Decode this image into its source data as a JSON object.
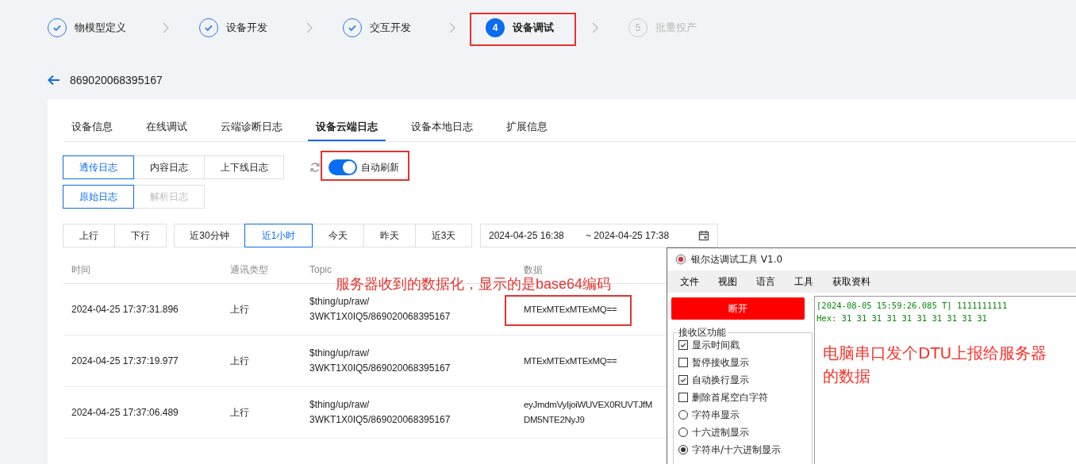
{
  "steps": [
    {
      "completed": true,
      "selected": false,
      "label": "物模型定义"
    },
    {
      "completed": true,
      "selected": false,
      "label": "设备开发"
    },
    {
      "completed": true,
      "selected": false,
      "label": "交互开发"
    },
    {
      "completed": false,
      "selected": true,
      "number": "4",
      "label": "设备调试",
      "highlighted": true
    },
    {
      "completed": false,
      "selected": false,
      "number": "5",
      "label": "批量投产"
    }
  ],
  "device_id": "869020068395167",
  "tabs": [
    {
      "label": "设备信息",
      "selected": false
    },
    {
      "label": "在线调试",
      "selected": false
    },
    {
      "label": "云端诊断日志",
      "selected": false
    },
    {
      "label": "设备云端日志",
      "selected": true
    },
    {
      "label": "设备本地日志",
      "selected": false
    },
    {
      "label": "扩展信息",
      "selected": false
    }
  ],
  "log_types": [
    {
      "label": "透传日志",
      "selected": true
    },
    {
      "label": "内容日志",
      "selected": false
    },
    {
      "label": "上下线日志",
      "selected": false
    }
  ],
  "log_formats": [
    {
      "label": "原始日志",
      "selected": true,
      "disabled": false
    },
    {
      "label": "解析日志",
      "selected": false,
      "disabled": true
    }
  ],
  "auto_refresh": {
    "label": "自动刷新",
    "on": true,
    "highlighted": true
  },
  "direction_filters": [
    {
      "label": "上行",
      "selected": false
    },
    {
      "label": "下行",
      "selected": false
    }
  ],
  "time_ranges": [
    {
      "label": "近30分钟",
      "selected": false
    },
    {
      "label": "近1小时",
      "selected": true
    },
    {
      "label": "今天",
      "selected": false
    },
    {
      "label": "昨天",
      "selected": false
    },
    {
      "label": "近3天",
      "selected": false
    }
  ],
  "date_range": {
    "start": "2024-04-25 16:38",
    "end": "~ 2024-04-25 17:38"
  },
  "table": {
    "columns": [
      "时间",
      "通讯类型",
      "Topic",
      "数据"
    ],
    "rows": [
      {
        "time": "2024-04-25 17:37:31.896",
        "type": "上行",
        "topic": [
          "$thing/up/raw/",
          "3WKT1X0IQ5/869020068395167"
        ],
        "data": [
          "MTExMTExMTExMQ=="
        ],
        "highlighted": true
      },
      {
        "time": "2024-04-25 17:37:19.977",
        "type": "上行",
        "topic": [
          "$thing/up/raw/",
          "3WKT1X0IQ5/869020068395167"
        ],
        "data": [
          "MTExMTExMTExMQ=="
        ],
        "highlighted": false
      },
      {
        "time": "2024-04-25 17:37:06.489",
        "type": "上行",
        "topic": [
          "$thing/up/raw/",
          "3WKT1X0IQ5/869020068395167"
        ],
        "data": [
          "eyJmdmVyIjoiWUVEX0RUVTJfM",
          "DM5NTE2NyJ9"
        ],
        "highlighted": false
      }
    ]
  },
  "server_note": "服务器收到的数据化，显示的是base64编码",
  "serial_tool": {
    "title": "银尔达调试工具 V1.0",
    "menu": [
      "文件",
      "视图",
      "语言",
      "工具",
      "获取资料"
    ],
    "button": "断开",
    "group_title": "接收区功能",
    "options": [
      {
        "kind": "checkbox",
        "label": "显示时间戳",
        "checked": true
      },
      {
        "kind": "checkbox",
        "label": "暂停接收显示",
        "checked": false
      },
      {
        "kind": "checkbox",
        "label": "自动换行显示",
        "checked": true
      },
      {
        "kind": "checkbox",
        "label": "删除首尾空白字符",
        "checked": false
      },
      {
        "kind": "radio",
        "label": "字符串显示",
        "selected": false
      },
      {
        "kind": "radio",
        "label": "十六进制显示",
        "selected": false
      },
      {
        "kind": "radio",
        "label": "字符串/十六进制显示",
        "selected": true
      }
    ],
    "receive_lines": [
      "[2024-08-05 15:59:26.085 T] 1111111111",
      "Hex: 31 31 31 31 31 31 31 31 31 31"
    ],
    "note": "电脑串口发个DTU上报给服务器的数据"
  }
}
